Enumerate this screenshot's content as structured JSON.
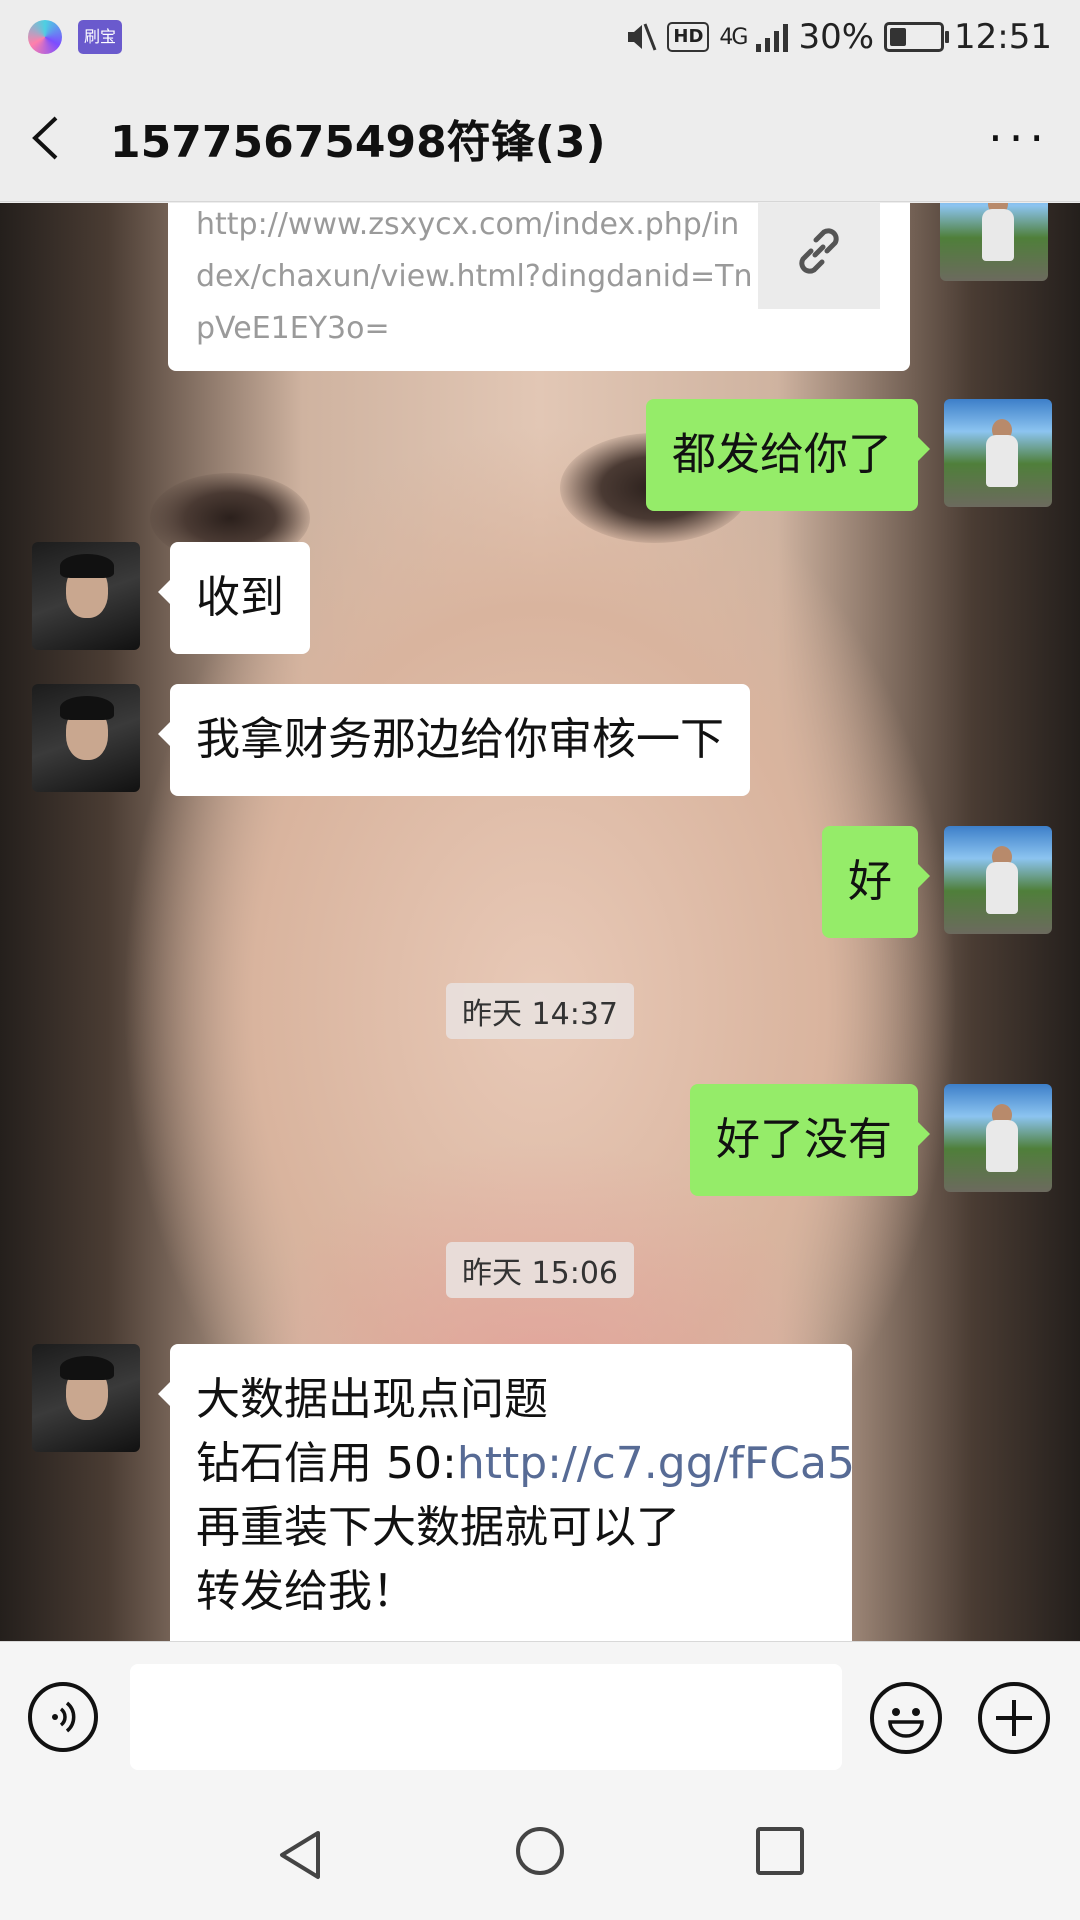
{
  "status_bar": {
    "app_badge_text": "刷宝",
    "network_hd": "HD",
    "network_type": "4G",
    "battery_percent": "30%",
    "battery_level": 0.3,
    "time": "12:51"
  },
  "header": {
    "title": "15775675498符锋(3)",
    "more_label": "···"
  },
  "chat": {
    "link_card_url": "http://www.zsxycx.com/index.php/index/chaxun/view.html?dingdanid=TnpVeE1EY3o=",
    "messages": [
      {
        "from": "me",
        "text": "都发给你了"
      },
      {
        "from": "other",
        "text": "收到"
      },
      {
        "from": "other",
        "text": "我拿财务那边给你审核一下"
      },
      {
        "from": "me",
        "text": "好"
      },
      {
        "from": "me",
        "text": "好了没有"
      }
    ],
    "timestamps": [
      "昨天 14:37",
      "昨天 15:06"
    ],
    "last_message": {
      "line1": "大数据出现点问题",
      "line2_prefix": "钻石信用 50:",
      "line2_link": "http://c7.gg/fFCa5",
      "line3": "再重装下大数据就可以了",
      "line4": "转发给我！"
    }
  },
  "icons": {
    "back": "chevron-left-icon",
    "more": "more-icon",
    "link": "link-icon",
    "voice": "voice-icon",
    "emoji": "emoji-icon",
    "plus": "plus-icon",
    "nav_back": "triangle-back-icon",
    "nav_home": "circle-home-icon",
    "nav_recent": "square-recent-icon"
  },
  "colors": {
    "my_bubble": "#95ec69",
    "their_bubble": "#ffffff",
    "link": "#576b95"
  }
}
